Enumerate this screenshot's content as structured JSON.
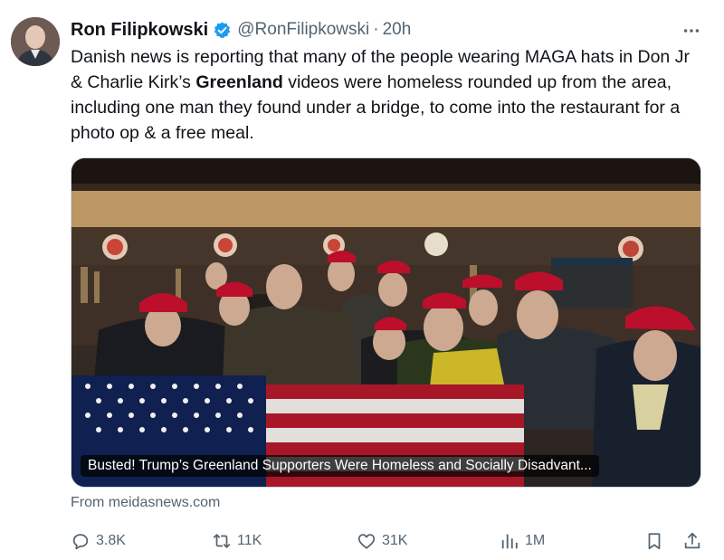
{
  "author": {
    "name": "Ron Filipkowski",
    "handle": "@RonFilipkowski",
    "separator": "·",
    "time": "20h"
  },
  "post": {
    "text_before": "Danish news is reporting that many of the people wearing MAGA hats in Don Jr & Charlie Kirk’s ",
    "text_bold": "Greenland",
    "text_after": " videos were homeless rounded up from the area, including one man they found under a bridge, to come into the restaurant for a photo op & a free meal."
  },
  "media": {
    "caption": "Busted! Trump’s Greenland Supporters Were Homeless and Socially Disadvant..."
  },
  "link_source": "From meidasnews.com",
  "metrics": {
    "replies": "3.8K",
    "reposts": "11K",
    "likes": "31K",
    "views": "1M"
  },
  "icons": {
    "verified": "verified-badge-icon",
    "more": "more-options-icon",
    "reply": "reply-icon",
    "repost": "repost-icon",
    "like": "heart-icon",
    "views": "views-chart-icon",
    "bookmark": "bookmark-icon",
    "share": "share-icon"
  },
  "colors": {
    "verified_blue": "#1d9bf0",
    "secondary_text": "#536471",
    "primary_text": "#0f1419"
  }
}
